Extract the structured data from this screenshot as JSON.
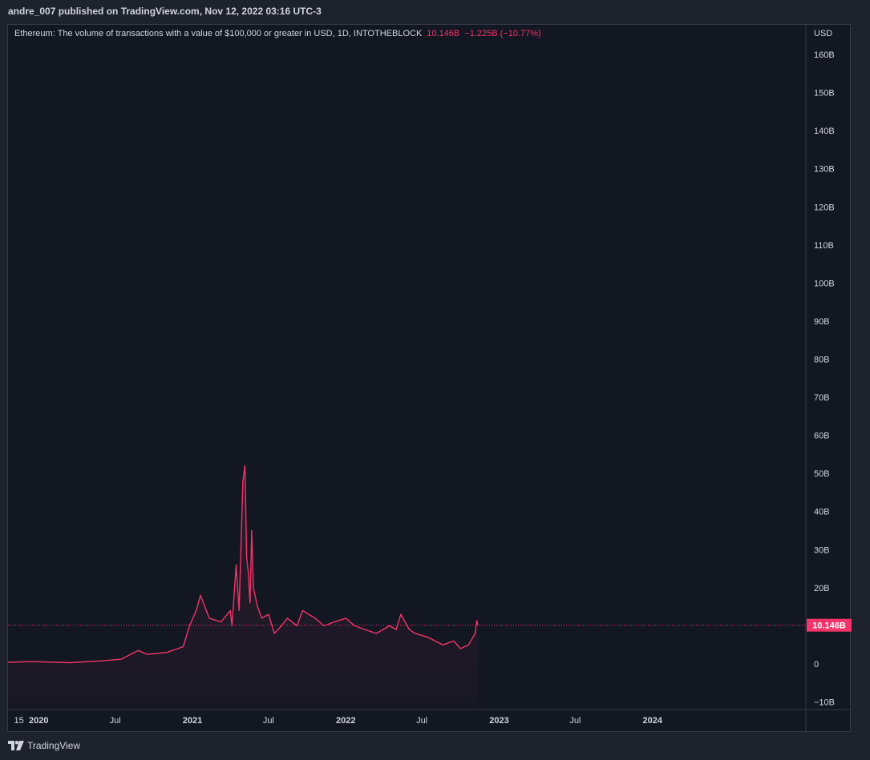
{
  "header": {
    "publisher_line": "andre_007 published on TradingView.com, Nov 12, 2022 03:16 UTC-3"
  },
  "legend": {
    "title": "Ethereum: The volume of transactions with a value of $100,000 or greater in USD, 1D, INTOTHEBLOCK",
    "last_value": "10.146B",
    "change": "−1.225B (−10.77%)"
  },
  "footer": {
    "brand": "TradingView"
  },
  "colors": {
    "series": "#f23468",
    "background": "#131722",
    "text": "#d1d4dc",
    "label_bg": "#f23468"
  },
  "chart_data": {
    "type": "area",
    "currency_label": "USD",
    "y_unit": "B",
    "ylim": [
      -12,
      168
    ],
    "xlim": [
      "2019-10-20",
      "2024-12-31"
    ],
    "y_ticks": [
      "160B",
      "150B",
      "140B",
      "130B",
      "120B",
      "110B",
      "100B",
      "90B",
      "80B",
      "70B",
      "60B",
      "50B",
      "40B",
      "30B",
      "20B",
      "10B",
      "0",
      "−10B"
    ],
    "y_tick_values": [
      160,
      150,
      140,
      130,
      120,
      110,
      100,
      90,
      80,
      70,
      60,
      50,
      40,
      30,
      20,
      10,
      0,
      -10
    ],
    "x_ticks": [
      "15",
      "2020",
      "Jul",
      "2021",
      "Jul",
      "2022",
      "Jul",
      "2023",
      "Jul",
      "2024"
    ],
    "x_tick_dates": [
      "2019-11-15",
      "2020-01-01",
      "2020-07-01",
      "2021-01-01",
      "2021-07-01",
      "2022-01-01",
      "2022-07-01",
      "2023-01-01",
      "2023-07-01",
      "2024-01-01"
    ],
    "x_tick_bold": [
      false,
      true,
      false,
      true,
      false,
      true,
      false,
      true,
      false,
      true
    ],
    "last_value": 10.146,
    "last_value_label": "10.146B",
    "series": [
      {
        "x": [
          "2019-10-20",
          "2019-12-15",
          "2020-03-15",
          "2020-06-01",
          "2020-07-15",
          "2020-08-25",
          "2020-09-15",
          "2020-11-01",
          "2020-12-10",
          "2020-12-25",
          "2021-01-10",
          "2021-01-20",
          "2021-02-10",
          "2021-03-10",
          "2021-04-01",
          "2021-04-05",
          "2021-04-15",
          "2021-04-22",
          "2021-05-01",
          "2021-05-06",
          "2021-05-10",
          "2021-05-14",
          "2021-05-18",
          "2021-05-22",
          "2021-05-26",
          "2021-06-05",
          "2021-06-15",
          "2021-07-01",
          "2021-07-15",
          "2021-08-01",
          "2021-08-15",
          "2021-09-07",
          "2021-09-20",
          "2021-10-20",
          "2021-11-10",
          "2021-12-05",
          "2022-01-01",
          "2022-01-22",
          "2022-02-15",
          "2022-03-15",
          "2022-04-15",
          "2022-05-01",
          "2022-05-12",
          "2022-06-01",
          "2022-06-15",
          "2022-07-15",
          "2022-08-20",
          "2022-09-15",
          "2022-10-01",
          "2022-10-20",
          "2022-11-05",
          "2022-11-09",
          "2022-11-11"
        ],
        "y": [
          0.4,
          0.6,
          0.3,
          0.8,
          1.2,
          3.5,
          2.5,
          3.0,
          4.5,
          10.0,
          14.0,
          18.0,
          12.0,
          11.0,
          14.0,
          10.0,
          26.0,
          14.0,
          48.0,
          52.0,
          28.0,
          24.0,
          16.0,
          35.0,
          20.0,
          15.0,
          12.0,
          13.0,
          8.0,
          10.0,
          12.0,
          10.0,
          14.0,
          12.0,
          10.0,
          11.0,
          12.0,
          10.0,
          9.0,
          8.0,
          10.0,
          9.0,
          13.0,
          9.0,
          8.0,
          7.0,
          5.0,
          6.0,
          4.0,
          5.0,
          8.0,
          11.4,
          10.146
        ]
      }
    ]
  }
}
